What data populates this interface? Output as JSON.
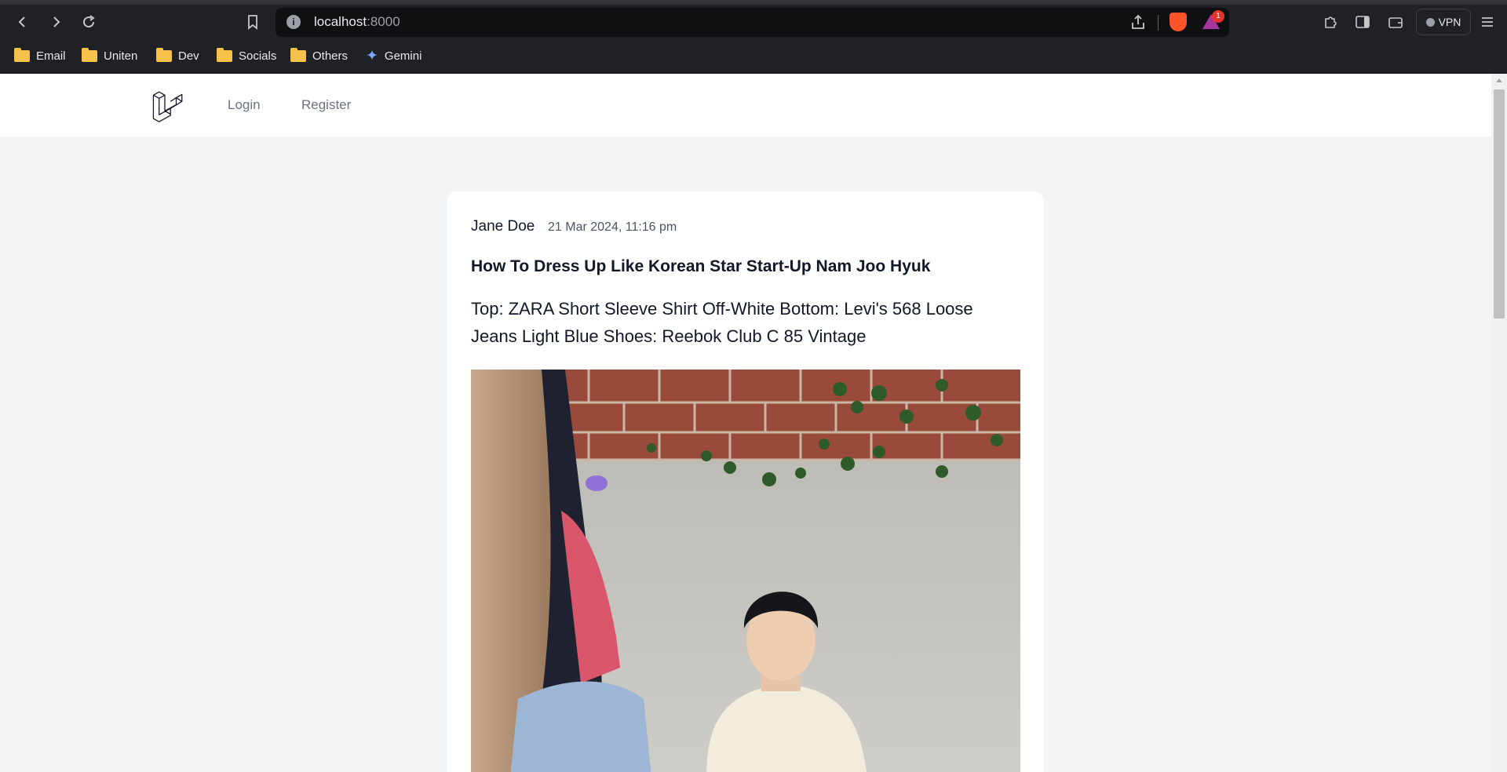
{
  "browser": {
    "url_host": "localhost",
    "url_port": ":8000",
    "rewards_badge": "1",
    "vpn_label": "VPN",
    "bookmarks": [
      {
        "label": "Email",
        "icon": "folder-icon"
      },
      {
        "label": "Uniten",
        "icon": "folder-icon"
      },
      {
        "label": "Dev",
        "icon": "folder-icon"
      },
      {
        "label": "Socials",
        "icon": "folder-icon"
      },
      {
        "label": "Others",
        "icon": "folder-icon"
      },
      {
        "label": "Gemini",
        "icon": "sparkle-icon"
      }
    ]
  },
  "nav": {
    "login": "Login",
    "register": "Register"
  },
  "post": {
    "author": "Jane Doe",
    "date": "21 Mar 2024, 11:16 pm",
    "title": "How To Dress Up Like Korean Star Start-Up Nam Joo Hyuk",
    "body": "Top: ZARA Short Sleeve Shirt Off-White Bottom: Levi's 568 Loose Jeans Light Blue Shoes: Reebok Club C 85 Vintage"
  },
  "colors": {
    "chrome_bg": "#202124",
    "page_bg": "#f3f4f6",
    "card_bg": "#ffffff",
    "nav_link": "#6b7280",
    "brave_orange": "#fb542b"
  }
}
